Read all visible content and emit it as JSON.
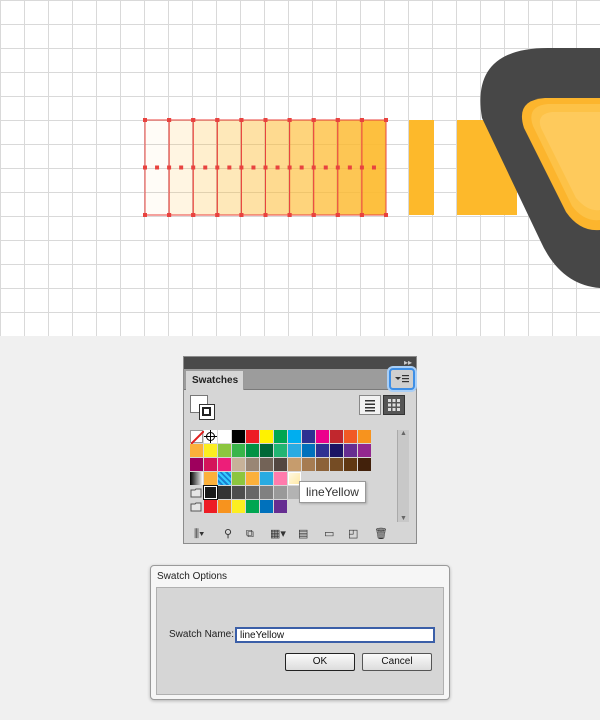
{
  "artboard": {
    "colors": {
      "selection": "#e8433f",
      "bar": "#fdb92b",
      "arrow_outline": "#474747",
      "arrow_fill": "#fcb52d",
      "grid": "#d9d9d9"
    }
  },
  "swatches_panel": {
    "tab_label": "Swatches",
    "menu_icon": "panel-menu-icon",
    "list_view_icon": "list-view-icon",
    "thumbnail_view_icon": "thumbnail-view-icon",
    "rows": [
      [
        "#ffffff",
        "#ffffff",
        "#ffffff",
        "#000000",
        "#ed1c24",
        "#fff200",
        "#00a651",
        "#00aeef",
        "#2e3192",
        "#ec008c",
        "#c1272d",
        "#f15a24",
        "#f7931e"
      ],
      [
        "#fbb03b",
        "#fcee21",
        "#8cc63f",
        "#39b54a",
        "#009245",
        "#006837",
        "#22b573",
        "#29abe2",
        "#0071bc",
        "#2e3192",
        "#1b1464",
        "#662d91",
        "#93278f"
      ],
      [
        "#9e005d",
        "#d4145a",
        "#ed1e79",
        "#c7b299",
        "#998675",
        "#736357",
        "#534741",
        "#c69c6d",
        "#a67c52",
        "#8c6239",
        "#754c24",
        "#603813",
        "#42210b"
      ],
      [
        "#cccccc",
        "#fbb03b",
        "#33ccff",
        "#8cc63f",
        "#fbb03b",
        "#29abe2",
        "#ff7bac",
        "#fff5d6"
      ],
      [
        "#1a1a1a",
        "#333333",
        "#4d4d4d",
        "#666666",
        "#808080",
        "#999999",
        "#b3b3b3",
        "#cccccc"
      ],
      [
        "#ed1c24",
        "#f7931e",
        "#fcee21",
        "#00a651",
        "#0071bc",
        "#662d91"
      ]
    ],
    "tooltip": "lineYellow",
    "toolbar_icons": [
      "swatch-libraries-icon",
      "show-kinds-icon",
      "swatch-options-icon",
      "new-color-group-icon",
      "new-swatch-icon",
      "delete-swatch-icon"
    ]
  },
  "swatch_options_dialog": {
    "title": "Swatch Options",
    "name_label": "Swatch Name:",
    "name_value": "lineYellow",
    "ok_label": "OK",
    "cancel_label": "Cancel"
  }
}
